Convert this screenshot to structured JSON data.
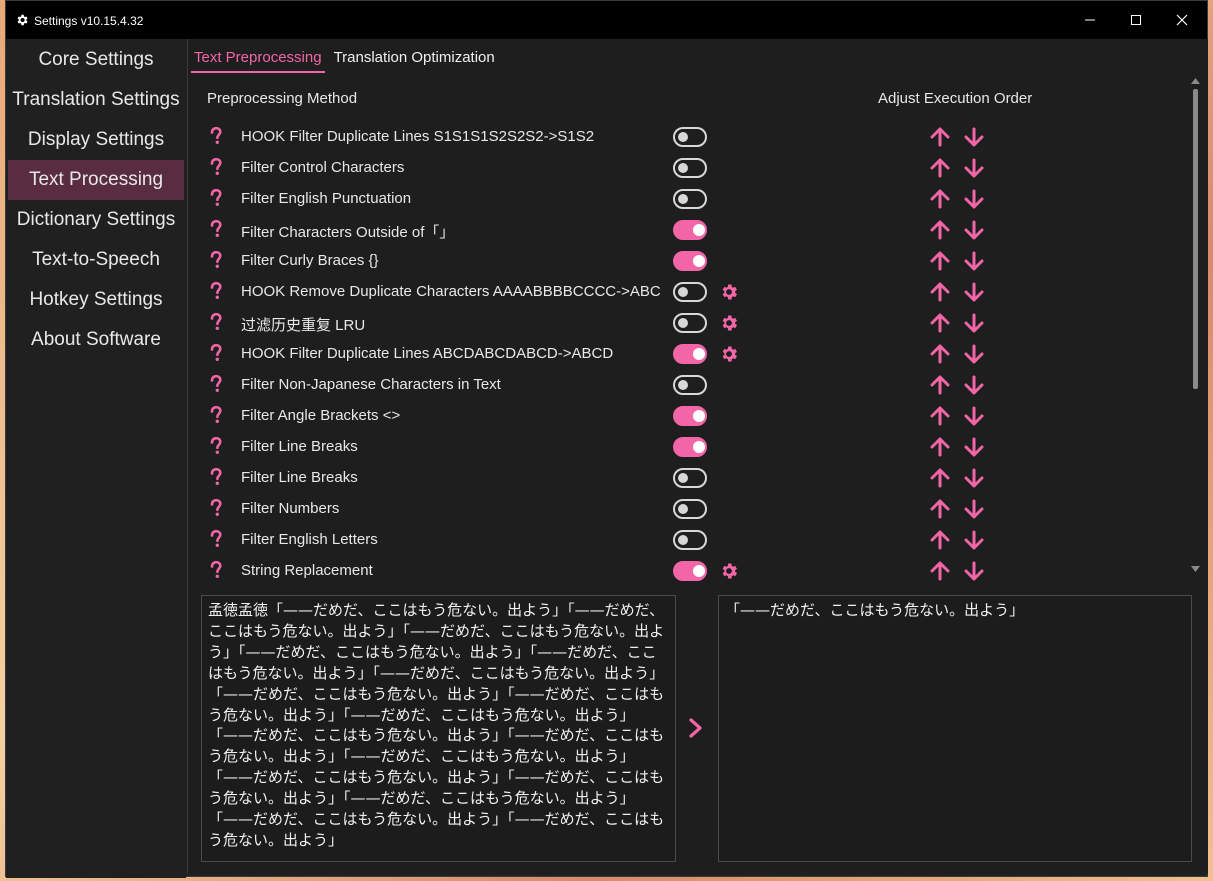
{
  "window": {
    "title": "Settings v10.15.4.32"
  },
  "sidebar": {
    "items": [
      {
        "label": "Core Settings"
      },
      {
        "label": "Translation Settings"
      },
      {
        "label": "Display Settings"
      },
      {
        "label": "Text Processing"
      },
      {
        "label": "Dictionary Settings"
      },
      {
        "label": "Text-to-Speech"
      },
      {
        "label": "Hotkey Settings"
      },
      {
        "label": "About Software"
      }
    ],
    "active_index": 3
  },
  "tabs": [
    {
      "label": "Text Preprocessing"
    },
    {
      "label": "Translation Optimization"
    }
  ],
  "list": {
    "header_method": "Preprocessing Method",
    "header_order": "Adjust Execution Order",
    "rows": [
      {
        "label": "HOOK Filter Duplicate Lines S1S1S1S2S2S2->S1S2",
        "enabled": false,
        "has_settings": false
      },
      {
        "label": "Filter Control Characters",
        "enabled": false,
        "has_settings": false
      },
      {
        "label": "Filter English Punctuation",
        "enabled": false,
        "has_settings": false
      },
      {
        "label": "Filter Characters Outside of「」",
        "enabled": true,
        "has_settings": false
      },
      {
        "label": "Filter Curly Braces {}",
        "enabled": true,
        "has_settings": false
      },
      {
        "label": "HOOK Remove Duplicate Characters AAAABBBBCCCC->ABC",
        "enabled": false,
        "has_settings": true
      },
      {
        "label": "过滤历史重复 LRU",
        "enabled": false,
        "has_settings": true
      },
      {
        "label": "HOOK Filter Duplicate Lines ABCDABCDABCD->ABCD",
        "enabled": true,
        "has_settings": true
      },
      {
        "label": "Filter Non-Japanese Characters in Text",
        "enabled": false,
        "has_settings": false
      },
      {
        "label": "Filter Angle Brackets <>",
        "enabled": true,
        "has_settings": false
      },
      {
        "label": "Filter Line Breaks",
        "enabled": true,
        "has_settings": false
      },
      {
        "label": "Filter Line Breaks",
        "enabled": false,
        "has_settings": false
      },
      {
        "label": "Filter Numbers",
        "enabled": false,
        "has_settings": false
      },
      {
        "label": "Filter English Letters",
        "enabled": false,
        "has_settings": false
      },
      {
        "label": "String Replacement",
        "enabled": true,
        "has_settings": true
      }
    ]
  },
  "input_text": "孟徳孟徳「——だめだ、ここはもう危ない。出よう」「——だめだ、ここはもう危ない。出よう」「——だめだ、ここはもう危ない。出よう」「——だめだ、ここはもう危ない。出よう」「——だめだ、ここはもう危ない。出よう」「——だめだ、ここはもう危ない。出よう」「——だめだ、ここはもう危ない。出よう」「——だめだ、ここはもう危ない。出よう」「——だめだ、ここはもう危ない。出よう」「——だめだ、ここはもう危ない。出よう」「——だめだ、ここはもう危ない。出よう」「——だめだ、ここはもう危ない。出よう」「——だめだ、ここはもう危ない。出よう」「——だめだ、ここはもう危ない。出よう」「——だめだ、ここはもう危ない。出よう」「——だめだ、ここはもう危ない。出よう」「——だめだ、ここはもう危ない。出よう」",
  "output_text": "「——だめだ、ここはもう危ない。出よう」",
  "colors": {
    "accent": "#f266a8",
    "active_nav": "#5a2c42",
    "background": "#202020"
  },
  "icons": {
    "help": "question-mark-icon",
    "settings": "gear-icon",
    "up": "arrow-up-icon",
    "down": "arrow-down-icon",
    "run": "chevron-right-icon"
  }
}
